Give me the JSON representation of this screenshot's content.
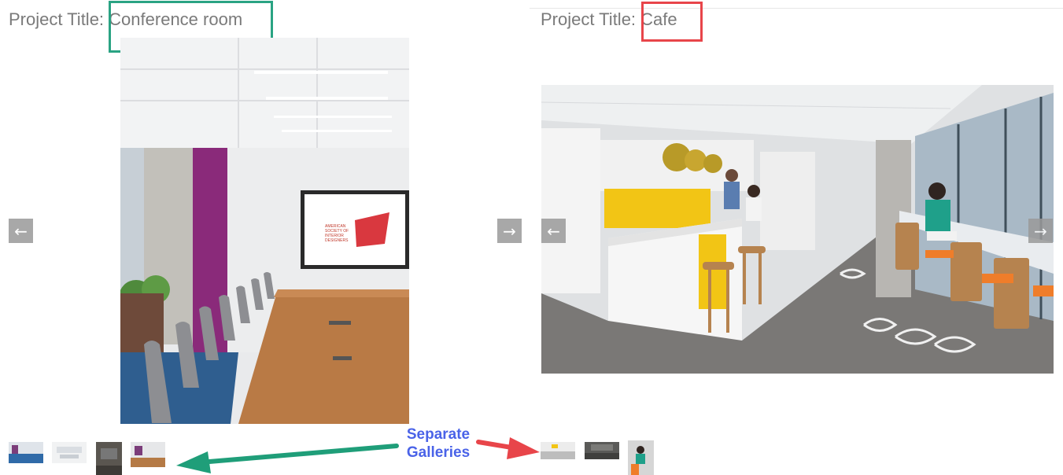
{
  "left_gallery": {
    "title_prefix": "Project Title:",
    "title_value": "Conference room",
    "prev_icon": "arrow-left-icon",
    "next_icon": "arrow-right-icon",
    "prev_glyph": "←",
    "next_glyph": "→",
    "image_logo_lines": [
      "AMERICAN",
      "SOCIETY OF",
      "INTERIOR",
      "DESIGNERS"
    ],
    "image_logo_mark": "ASID",
    "thumbnails": 4,
    "highlight_color": "#2aa383"
  },
  "right_gallery": {
    "title_prefix": "Project Title:",
    "title_value": "Cafe",
    "prev_icon": "arrow-left-icon",
    "next_icon": "arrow-right-icon",
    "prev_glyph": "←",
    "next_glyph": "→",
    "thumbnails": 3,
    "highlight_color": "#e8454a"
  },
  "annotation": {
    "line1": "Separate",
    "line2": "Galleries",
    "text_color": "#4a63e8",
    "left_arrow_color": "#1f9e79",
    "right_arrow_color": "#e8454a"
  }
}
